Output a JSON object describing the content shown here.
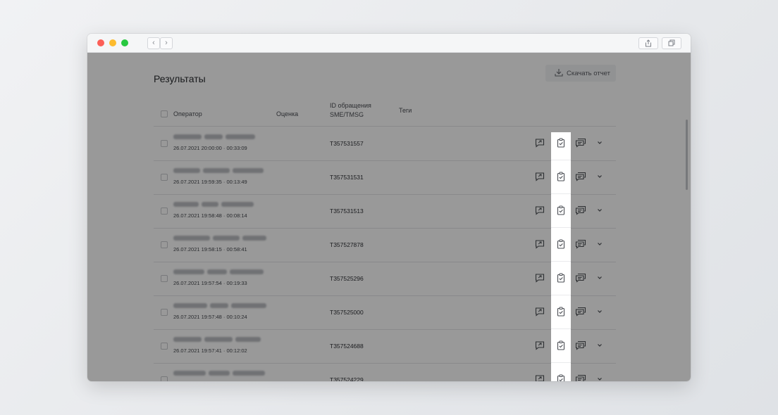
{
  "window": {
    "nav_back": "‹",
    "nav_forward": "›",
    "share_icon": "share-icon",
    "tabs_icon": "tabs-icon"
  },
  "page": {
    "title": "Результаты",
    "download_label": "Скачать отчет"
  },
  "table": {
    "headers": {
      "operator": "Оператор",
      "rating": "Оценка",
      "request_id_line1": "ID обращения",
      "request_id_line2": "SME/TMSG",
      "tags": "Теги"
    },
    "rows": [
      {
        "date": "26.07.2021 20:00:00 · 00:33:09",
        "id": "T357531557"
      },
      {
        "date": "26.07.2021 19:59:35 · 00:13:49",
        "id": "T357531531"
      },
      {
        "date": "26.07.2021 19:58:48 · 00:08:14",
        "id": "T357531513"
      },
      {
        "date": "26.07.2021 19:58:15 · 00:58:41",
        "id": "T357527878"
      },
      {
        "date": "26.07.2021 19:57:54 · 00:19:33",
        "id": "T357525296"
      },
      {
        "date": "26.07.2021 19:57:48 · 00:10:24",
        "id": "T357525000"
      },
      {
        "date": "26.07.2021 19:57:41 · 00:12:02",
        "id": "T357524688"
      },
      {
        "date": "",
        "id": "T357524229"
      }
    ],
    "row_icons": [
      "feedback-icon",
      "clipboard-check-icon",
      "chat-icon",
      "chevron-down-icon"
    ]
  },
  "colors": {
    "overlay": "rgba(0,0,0,0.4)",
    "highlight": "#ffffff"
  }
}
